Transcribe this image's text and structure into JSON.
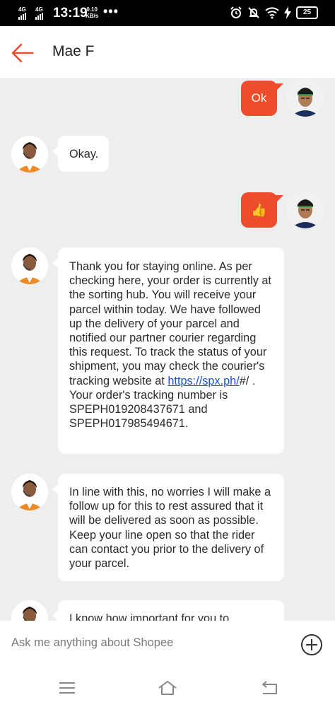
{
  "status_bar": {
    "network1": "4G",
    "network2": "4G",
    "time": "13:19",
    "speed_value": "0.10",
    "speed_unit": "KB/s",
    "more": "•••",
    "battery": "25"
  },
  "header": {
    "contact_name": "Mae F"
  },
  "messages": [
    {
      "side": "out",
      "text": "Ok"
    },
    {
      "side": "in",
      "text": "Okay."
    },
    {
      "side": "out",
      "emoji": "👍",
      "icon": "thumbs-up-icon"
    },
    {
      "side": "in",
      "text_before_link": "Thank you for staying online. As per checking here, your order  is currently at the sorting hub. You will receive your parcel within today.  We have followed up the delivery of your parcel and notified our partner courier regarding this request. To track the status of your shipment, you may check the courier's tracking website at ",
      "link": "https://spx.ph/",
      "text_after_link": "#/ . Your order's tracking number is SPEPH019208437671  and SPEPH017985494671."
    },
    {
      "side": "in",
      "text": "In line with this, no worries I will make a follow up for this to rest assured that it will be delivered as soon as possible. Keep your line open so that the rider can contact you prior to the delivery of your parcel."
    },
    {
      "side": "in",
      "text": "I know how important for you to"
    }
  ],
  "input": {
    "placeholder": "Ask me anything about Shopee"
  },
  "colors": {
    "accent": "#ee4d2d",
    "background": "#eeeeee",
    "link": "#1a4fd6"
  }
}
